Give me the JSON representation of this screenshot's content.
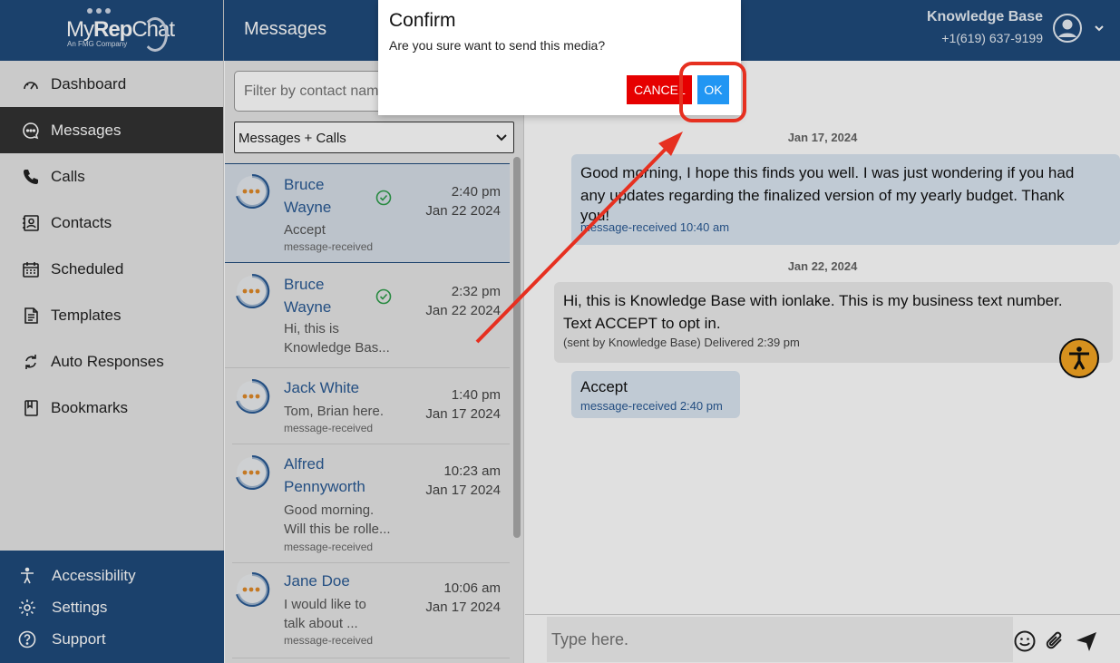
{
  "logo": {
    "brand_light": "My",
    "brand_bold": "Rep",
    "brand_end": "Chat",
    "sub": "An FMG Company"
  },
  "sidebar": {
    "items": [
      {
        "label": "Dashboard",
        "icon": "gauge-icon",
        "active": false
      },
      {
        "label": "Messages",
        "icon": "chat-bubble-icon",
        "active": true
      },
      {
        "label": "Calls",
        "icon": "phone-icon",
        "active": false
      },
      {
        "label": "Contacts",
        "icon": "contact-card-icon",
        "active": false
      },
      {
        "label": "Scheduled",
        "icon": "calendar-icon",
        "active": false
      },
      {
        "label": "Templates",
        "icon": "document-icon",
        "active": false
      },
      {
        "label": "Auto Responses",
        "icon": "refresh-icon",
        "active": false
      },
      {
        "label": "Bookmarks",
        "icon": "bookmark-icon",
        "active": false
      }
    ],
    "bottom": [
      {
        "label": "Accessibility",
        "icon": "accessibility-icon"
      },
      {
        "label": "Settings",
        "icon": "gear-icon"
      },
      {
        "label": "Support",
        "icon": "help-icon"
      }
    ]
  },
  "header": {
    "title": "Messages",
    "user_name": "Knowledge Base",
    "user_phone": "+1(619) 637-9199"
  },
  "list": {
    "filter_placeholder": "Filter by contact name",
    "filter_visible": "Filter by contact na",
    "select_value": "Messages + Calls",
    "conversations": [
      {
        "name1": "Bruce",
        "name2": "Wayne",
        "preview1": "Accept",
        "preview2": "",
        "status": "message-received",
        "time": "2:40 pm",
        "date": "Jan 22 2024",
        "checked": true,
        "selected": true
      },
      {
        "name1": "Bruce",
        "name2": "Wayne",
        "preview1": "Hi, this is",
        "preview2": "Knowledge Bas...",
        "status": "",
        "time": "2:32 pm",
        "date": "Jan 22 2024",
        "checked": true,
        "selected": false
      },
      {
        "name1": "Jack White",
        "name2": "",
        "preview1": "Tom, Brian here.",
        "preview2": "",
        "status": "message-received",
        "time": "1:40 pm",
        "date": "Jan 17 2024",
        "checked": false,
        "selected": false
      },
      {
        "name1": "Alfred",
        "name2": "Pennyworth",
        "preview1": "Good morning.",
        "preview2": "Will this be rolle...",
        "status": "message-received",
        "time": "10:23 am",
        "date": "Jan 17 2024",
        "checked": false,
        "selected": false
      },
      {
        "name1": "Jane Doe",
        "name2": "",
        "preview1": "I would like to",
        "preview2": "talk about ...",
        "status": "message-received",
        "time": "10:06 am",
        "date": "Jan 17 2024",
        "checked": false,
        "selected": false
      }
    ]
  },
  "chat": {
    "date1": "Jan 17, 2024",
    "msg1_line1": "Good morning, I hope this finds you well. I was just wondering if you had",
    "msg1_line2": "any updates regarding the finalized version of my yearly budget. Thank",
    "msg1_line3": "you!",
    "msg1_meta": "message-received 10:40 am",
    "date2": "Jan 22, 2024",
    "msg2_line1": "Hi, this is Knowledge Base with ionlake. This is my business text number.",
    "msg2_line2": "Text ACCEPT to opt in.",
    "msg2_meta": "(sent by Knowledge Base) Delivered 2:39 pm",
    "msg3_text": "Accept",
    "msg3_meta": "message-received 2:40 pm",
    "compose_placeholder": "Type here."
  },
  "dialog": {
    "title": "Confirm",
    "message": "Are you sure want to send this media?",
    "cancel_label": "CANCEL",
    "ok_label": "OK"
  },
  "colors": {
    "brand_blue": "#1f4a7c",
    "cancel_red": "#e60000",
    "ok_blue": "#2196f3",
    "highlight_red": "#e63020",
    "accessibility_orange": "#f5a623"
  }
}
